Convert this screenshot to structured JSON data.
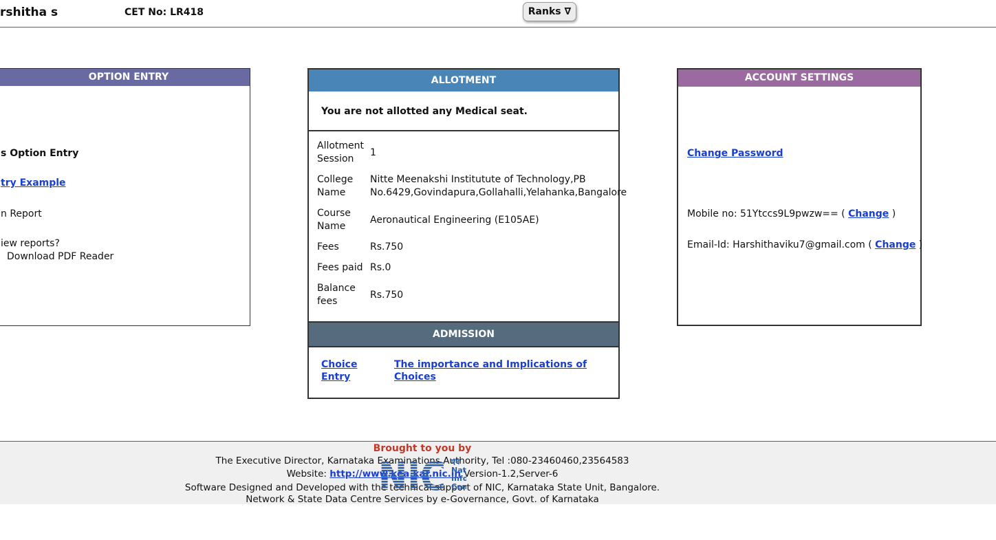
{
  "header": {
    "user_name": "rshitha s",
    "cet_label": "CET No: LR418",
    "ranks_button": "Ranks ∇"
  },
  "option_entry": {
    "title": "OPTION ENTRY",
    "lines": [
      "s Option Entry",
      "try Example",
      "n Report",
      "iew reports?",
      "Download PDF Reader"
    ]
  },
  "allotment": {
    "title": "ALLOTMENT",
    "notice": "You are not allotted any Medical seat.",
    "rows": [
      {
        "label": "Allotment Session",
        "value": "1"
      },
      {
        "label": "College Name",
        "value": "Nitte Meenakshi Institutute of Technology,PB No.6429,Govindapura,Gollahalli,Yelahanka,Bangalore"
      },
      {
        "label": "Course Name",
        "value": "Aeronautical Engineering (E105AE)"
      },
      {
        "label": "Fees",
        "value": "Rs.750"
      },
      {
        "label": "Fees paid",
        "value": "Rs.0"
      },
      {
        "label": "Balance fees",
        "value": "Rs.750"
      }
    ]
  },
  "admission": {
    "title": "ADMISSION",
    "choice_entry": "Choice Entry",
    "importance_link": "The importance and Implications of Choices"
  },
  "account": {
    "title": "ACCOUNT SETTINGS",
    "change_password": "Change Password",
    "mobile_label": "Mobile no: 51Ytccs9L9pwzw== (",
    "email_label": "Email-Id: Harshithaviku7@gmail.com (",
    "change_link": "Change",
    "close_paren": ")"
  },
  "footer": {
    "brought": "Brought to you by",
    "line1": "The Executive Director, Karnataka Examinations Authority, Tel :080-23460460,23564583",
    "website_label": "Website:",
    "website_link": "http://www.kea.kar.nic.in",
    "version": "Version-1.2,Server-6",
    "line3": "Software Designed and Developed with the technical support of NIC, Karnataka State Unit, Bangalore.",
    "line4": "Network & State Data Centre Services by e-Governance, Govt. of Karnataka",
    "logo_text": "NIC",
    "logo_side": [
      "एन",
      "Nati",
      "Info",
      "Cen"
    ]
  }
}
